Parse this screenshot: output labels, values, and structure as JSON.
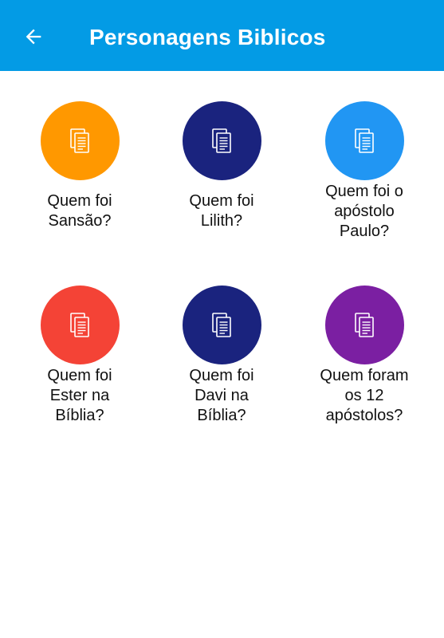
{
  "app_bar": {
    "title": "Personagens Biblicos",
    "background": "#039be5",
    "back_icon": "arrow-left-icon"
  },
  "items": [
    {
      "label_lines": [
        "Quem foi",
        "Sansão?"
      ],
      "color": "#ff9800",
      "icon": "documents-icon"
    },
    {
      "label_lines": [
        "Quem foi",
        "Lilith?"
      ],
      "color": "#1a237e",
      "icon": "documents-icon"
    },
    {
      "label_lines": [
        "Quem foi o",
        "apóstolo",
        "Paulo?"
      ],
      "color": "#2196f3",
      "icon": "documents-icon"
    },
    {
      "label_lines": [
        "Quem foi",
        "Ester na",
        "Bíblia?"
      ],
      "color": "#f44336",
      "icon": "documents-icon"
    },
    {
      "label_lines": [
        "Quem foi",
        "Davi na",
        "Bíblia?"
      ],
      "color": "#1a237e",
      "icon": "documents-icon"
    },
    {
      "label_lines": [
        "Quem foram",
        "os 12",
        "apóstolos?"
      ],
      "color": "#7b1fa2",
      "icon": "documents-icon"
    }
  ]
}
